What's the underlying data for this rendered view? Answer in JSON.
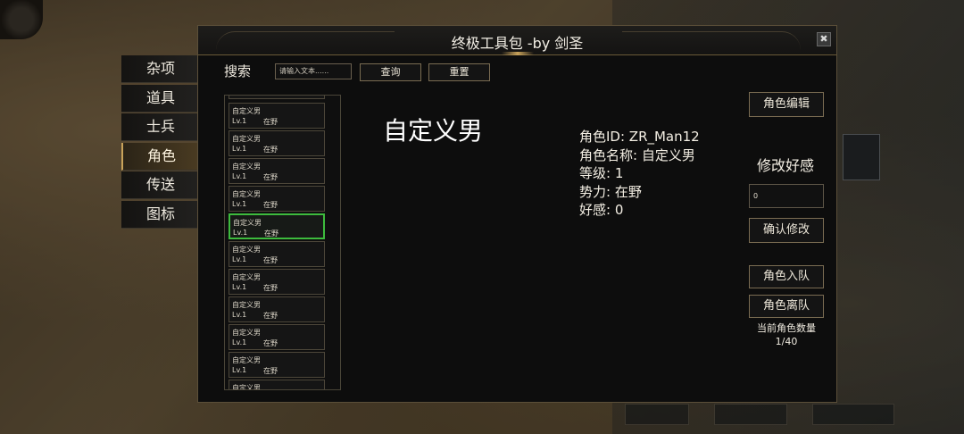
{
  "window": {
    "title": "终极工具包 -by 剑圣",
    "close_glyph": "✖"
  },
  "side_menu": {
    "items": [
      {
        "label": "杂项"
      },
      {
        "label": "道具"
      },
      {
        "label": "士兵"
      },
      {
        "label": "角色",
        "active": true
      },
      {
        "label": "传送"
      },
      {
        "label": "图标"
      }
    ]
  },
  "search": {
    "label": "搜索",
    "placeholder": "请输入文本......",
    "query_button": "查询",
    "reset_button": "重置"
  },
  "character_list": [
    {
      "name": "自定义男",
      "level": "Lv.1",
      "faction": "在野"
    },
    {
      "name": "自定义男",
      "level": "Lv.1",
      "faction": "在野"
    },
    {
      "name": "自定义男",
      "level": "Lv.1",
      "faction": "在野"
    },
    {
      "name": "自定义男",
      "level": "Lv.1",
      "faction": "在野"
    },
    {
      "name": "自定义男",
      "level": "Lv.1",
      "faction": "在野",
      "selected": true
    },
    {
      "name": "自定义男",
      "level": "Lv.1",
      "faction": "在野"
    },
    {
      "name": "自定义男",
      "level": "Lv.1",
      "faction": "在野"
    },
    {
      "name": "自定义男",
      "level": "Lv.1",
      "faction": "在野"
    },
    {
      "name": "自定义男",
      "level": "Lv.1",
      "faction": "在野"
    },
    {
      "name": "自定义男",
      "level": "Lv.1",
      "faction": "在野"
    },
    {
      "name": "自定义男",
      "level": "",
      "faction": ""
    }
  ],
  "detail": {
    "name": "自定义男",
    "id_line": "角色ID: ZR_Man12",
    "name_line": "角色名称: 自定义男",
    "level_line": "等级: 1",
    "faction_line": "势力: 在野",
    "favor_line": "好感: 0"
  },
  "actions": {
    "edit_button": "角色编辑",
    "favor_title": "修改好感",
    "favor_value": "0",
    "confirm_button": "确认修改",
    "join_button": "角色入队",
    "leave_button": "角色离队",
    "count_label": "当前角色数量",
    "count_value": "1/40"
  },
  "colors": {
    "accent_gold": "#c8a25a",
    "selected_green": "#3dbb3d"
  }
}
